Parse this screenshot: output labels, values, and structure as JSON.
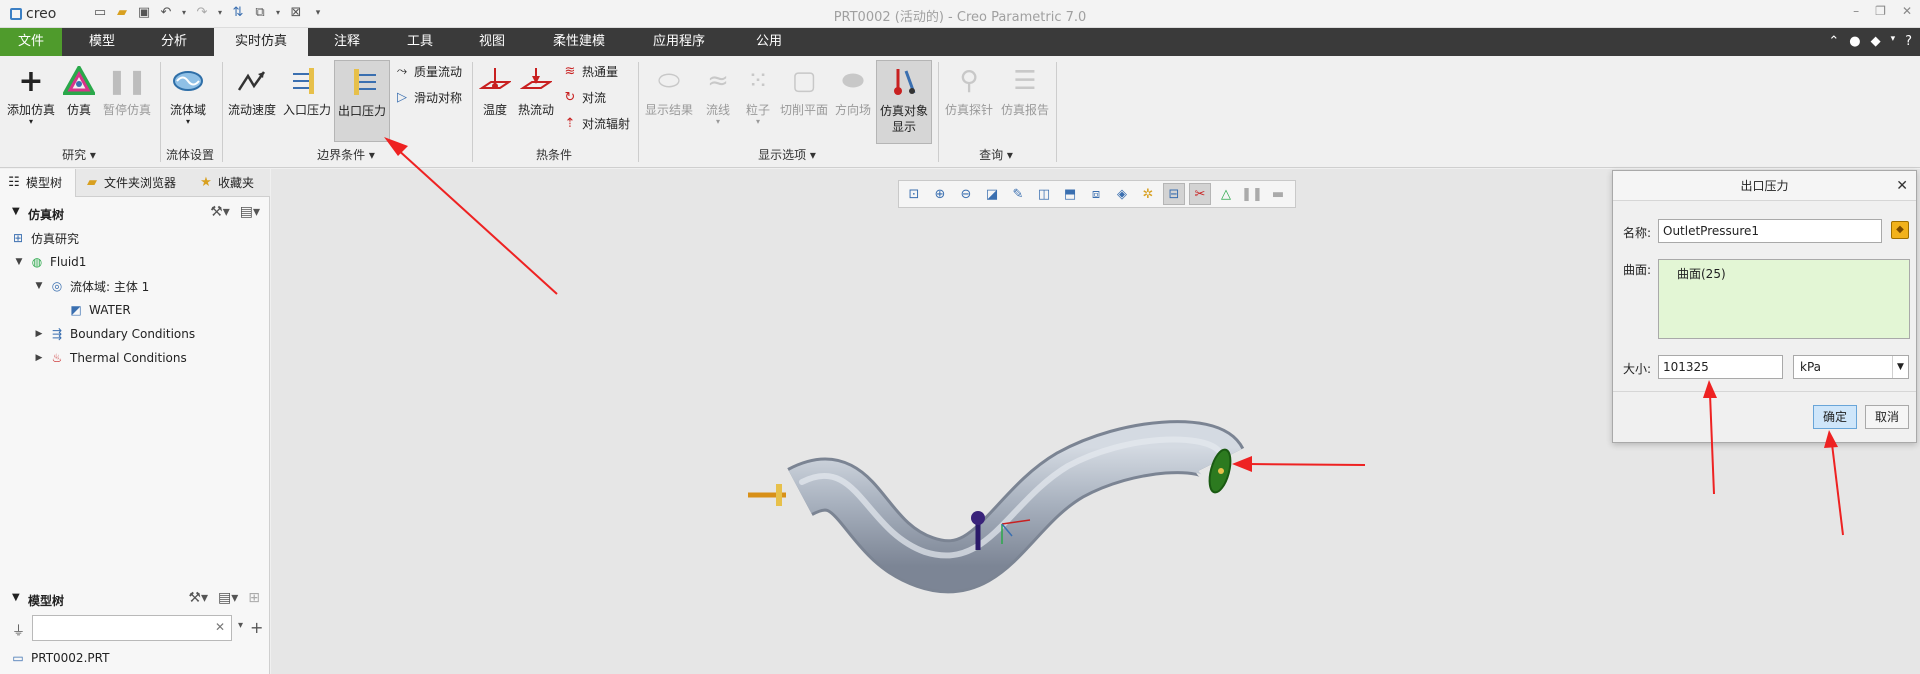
{
  "titlebar": {
    "logo": "creo",
    "title": "PRT0002 (活动的) - Creo Parametric 7.0"
  },
  "menu": {
    "tabs": [
      "文件",
      "模型",
      "分析",
      "实时仿真",
      "注释",
      "工具",
      "视图",
      "柔性建模",
      "应用程序",
      "公用"
    ],
    "active": "实时仿真"
  },
  "ribbon": {
    "study": {
      "add_sim": "添加仿真",
      "simulate": "仿真",
      "pause": "暂停仿真",
      "group": "研究"
    },
    "fluid": {
      "domain": "流体域",
      "group": "流体设置"
    },
    "boundary": {
      "flow_velocity": "流动速度",
      "inlet_pressure": "入口压力",
      "outlet_pressure": "出口压力",
      "mass_flow": "质量流动",
      "slip_symmetry": "滑动对称",
      "group": "边界条件"
    },
    "thermal": {
      "temperature": "温度",
      "heat_flow": "热流动",
      "heat_flux": "热通量",
      "convection": "对流",
      "conv_radiation": "对流辐射",
      "group": "热条件"
    },
    "display": {
      "show_results": "显示结果",
      "streamlines": "流线",
      "particles": "粒子",
      "cut_plane": "切削平面",
      "direction_field": "方向场",
      "sim_object_display_1": "仿真对象",
      "sim_object_display_2": "显示",
      "group": "显示选项"
    },
    "query": {
      "probe": "仿真探针",
      "report": "仿真报告",
      "group": "查询"
    }
  },
  "left_panel": {
    "tabs": [
      "模型树",
      "文件夹浏览器",
      "收藏夹"
    ],
    "sim_tree": {
      "header": "仿真树",
      "study": "仿真研究",
      "fluid": "Fluid1",
      "domain": "流体域: 主体 1",
      "material": "WATER",
      "boundary": "Boundary Conditions",
      "thermal": "Thermal Conditions"
    },
    "model_tree": {
      "header": "模型树",
      "part": "PRT0002.PRT"
    },
    "filter": {
      "placeholder": ""
    }
  },
  "dialog": {
    "title": "出口压力",
    "name_label": "名称:",
    "name_value": "OutletPressure1",
    "surface_label": "曲面:",
    "surface_value": "曲面(25)",
    "size_label": "大小:",
    "size_value": "101325",
    "unit": "kPa",
    "ok": "确定",
    "cancel": "取消"
  },
  "colors": {
    "file_tab": "#4f9b2c",
    "menubar": "#3a3a3a",
    "annotation_arrow": "#ee2222",
    "surface_box": "#e3f6d5",
    "pipe": "#a9b2bf"
  }
}
